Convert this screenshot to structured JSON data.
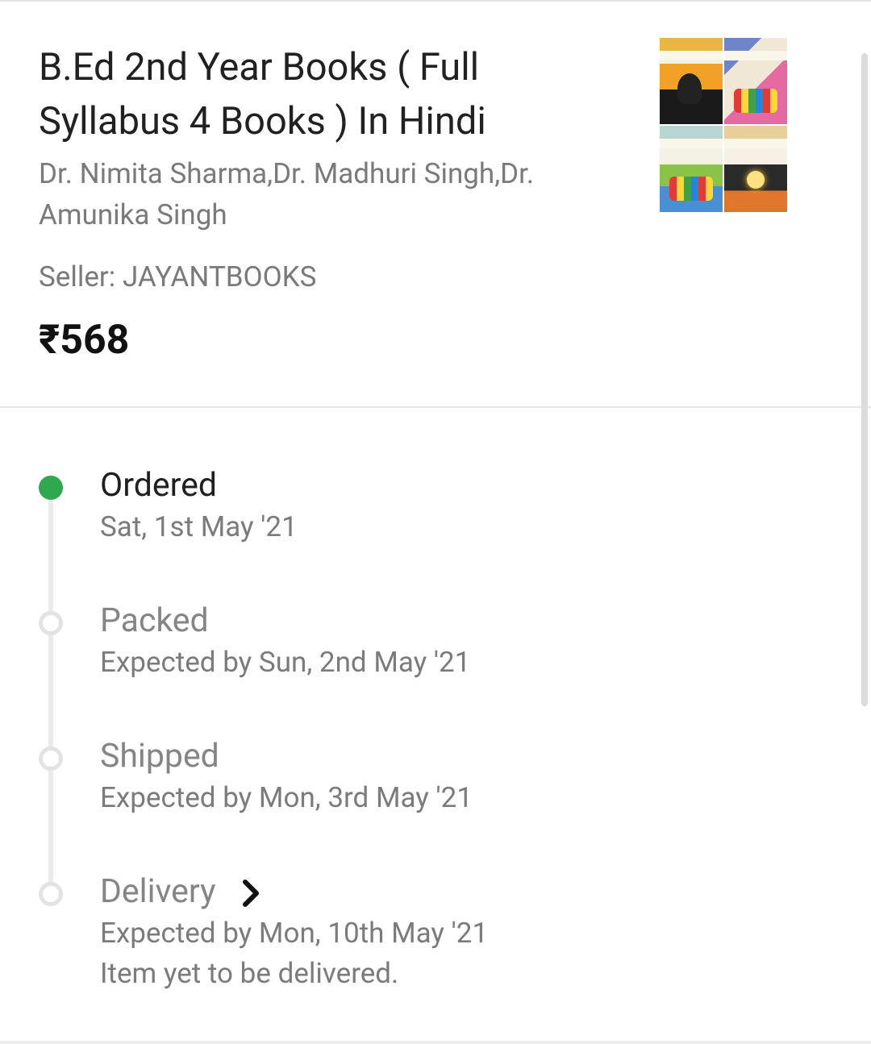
{
  "product": {
    "title": "B.Ed 2nd Year Books ( Full Syllabus 4 Books ) In Hindi",
    "authors": "Dr. Nimita Sharma,Dr. Madhuri Singh,Dr. Amunika Singh",
    "seller": "Seller: JAYANTBOOKS",
    "price": "₹568",
    "thumbnail_icon": "book-cover-collage"
  },
  "timeline": {
    "accent_color": "#2fa84f",
    "steps": [
      {
        "label": "Ordered",
        "date": "Sat, 1st May '21",
        "status": "done"
      },
      {
        "label": "Packed",
        "date": "Expected by Sun, 2nd May '21",
        "status": "pending"
      },
      {
        "label": "Shipped",
        "date": "Expected by Mon, 3rd May '21",
        "status": "pending"
      },
      {
        "label": "Delivery",
        "date": "Expected by Mon, 10th May '21",
        "note": "Item yet to be delivered.",
        "status": "pending",
        "icon": "chevron-right-icon"
      }
    ]
  }
}
